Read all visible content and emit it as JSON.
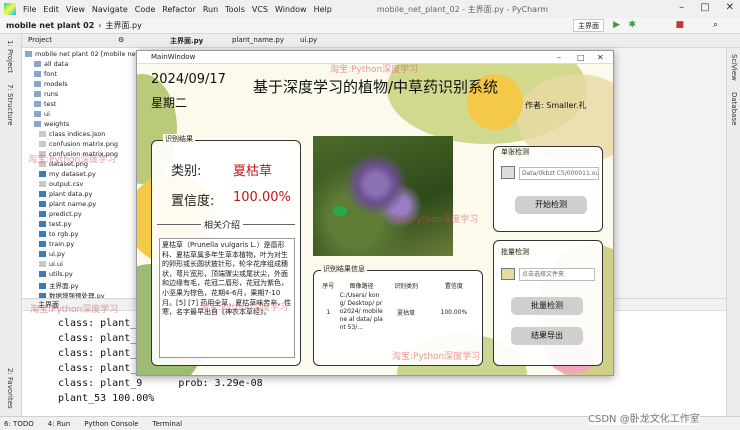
{
  "ide": {
    "menu": [
      "File",
      "Edit",
      "View",
      "Navigate",
      "Code",
      "Refactor",
      "Run",
      "Tools",
      "VCS",
      "Window",
      "Help"
    ],
    "title": "mobile_net_plant_02 - 主界面.py - PyCharm",
    "nav_project": "mobile net plant 02",
    "nav_file": "主界面.py",
    "run_config": "主界面",
    "tabs": [
      "主界面.py",
      "plant_name.py",
      "ui.py"
    ],
    "project_label": "Project",
    "project_root": "mobile net plant 02 [mobile net",
    "tree": [
      "all data",
      "font",
      "models",
      "runs",
      "test",
      "ui",
      "weights",
      "class indices.json",
      "confusion matrix.png",
      "confusion matrix.png",
      "dataset.png",
      "my dataset.py",
      "output.csv",
      "plant data.py",
      "plant name.py",
      "predict.py",
      "test.py",
      "to rgb.py",
      "train.py",
      "ui.py",
      "ui.ui",
      "utils.py",
      "主界面.py",
      "数据增强预处理.py"
    ],
    "run_tab": "主界面",
    "console": [
      "class: plant_6",
      "class: plant_6",
      "class: plant_7",
      "class: plant_8",
      "class: plant_9      prob: 3.29e-08",
      "plant_53 100.00%"
    ],
    "bottom_tabs": [
      "6: TODO",
      "4: Run",
      "Python Console",
      "Terminal"
    ],
    "left_strip": [
      "1: Project",
      "7: Structure",
      "2: Favorites"
    ],
    "right_strip": [
      "SciView",
      "Database"
    ]
  },
  "app": {
    "window_title": "MainWindow",
    "date": "2024/09/17",
    "weekday": "星期二",
    "title": "基于深度学习的植物/中草药识别系统",
    "author": "作者: Smaller.礼",
    "result_group": "识别结果",
    "class_label": "类别:",
    "class_value": "夏枯草",
    "conf_label": "置信度:",
    "conf_value": "100.00%",
    "intro_title": "相关介绍",
    "intro_text": "夏枯草（Prunella vulgaris L.）是唇形科、夏枯草属多年生草本植物，叶为对生的卵形或长圆状披针形，轮伞花序组成穗状，萼片宽形，顶端骤尖或尾状尖，外面和边缘有毛，花冠二唇形，花冠为紫色，小坚果为棕色，花期4-6月，果期7-10月。[5] [7] 药用全草，夏枯草味苦辛，性寒，名字最早出自《神农本草经》。",
    "single_group": "单张检测",
    "single_path": "Data/0kbzt C5/000011.ouc",
    "start_button": "开始检测",
    "batch_group": "批量检测",
    "batch_placeholder": "点击选择文件夹",
    "batch_button": "批量检测",
    "export_button": "结果导出",
    "table_group": "识别结果信息",
    "table_headers": [
      "序号",
      "图像路径",
      "识别类别",
      "置信度"
    ],
    "table_rows": [
      {
        "idx": "1",
        "path": "C:/Users/ kong/ Desktop/ pro2024/ mobile ne al data/ plant 53/...",
        "cls": "夏枯草",
        "conf": "100.00%"
      }
    ]
  },
  "watermarks": [
    "淘宝:Python深度学习",
    "淘宝:Python深度学习",
    "淘宝:Python深度学习",
    "淘宝:Python深度学习",
    "淘宝:Python深度学习",
    "淘宝:Python深度学习"
  ],
  "footer_credit": "CSDN @卧龙文化工作室",
  "colors": {
    "accent_red": "#c0171a",
    "app_bg": "#fbfaed",
    "leaf_green": "#a9bf5a",
    "flower_yellow": "#f5c948"
  }
}
